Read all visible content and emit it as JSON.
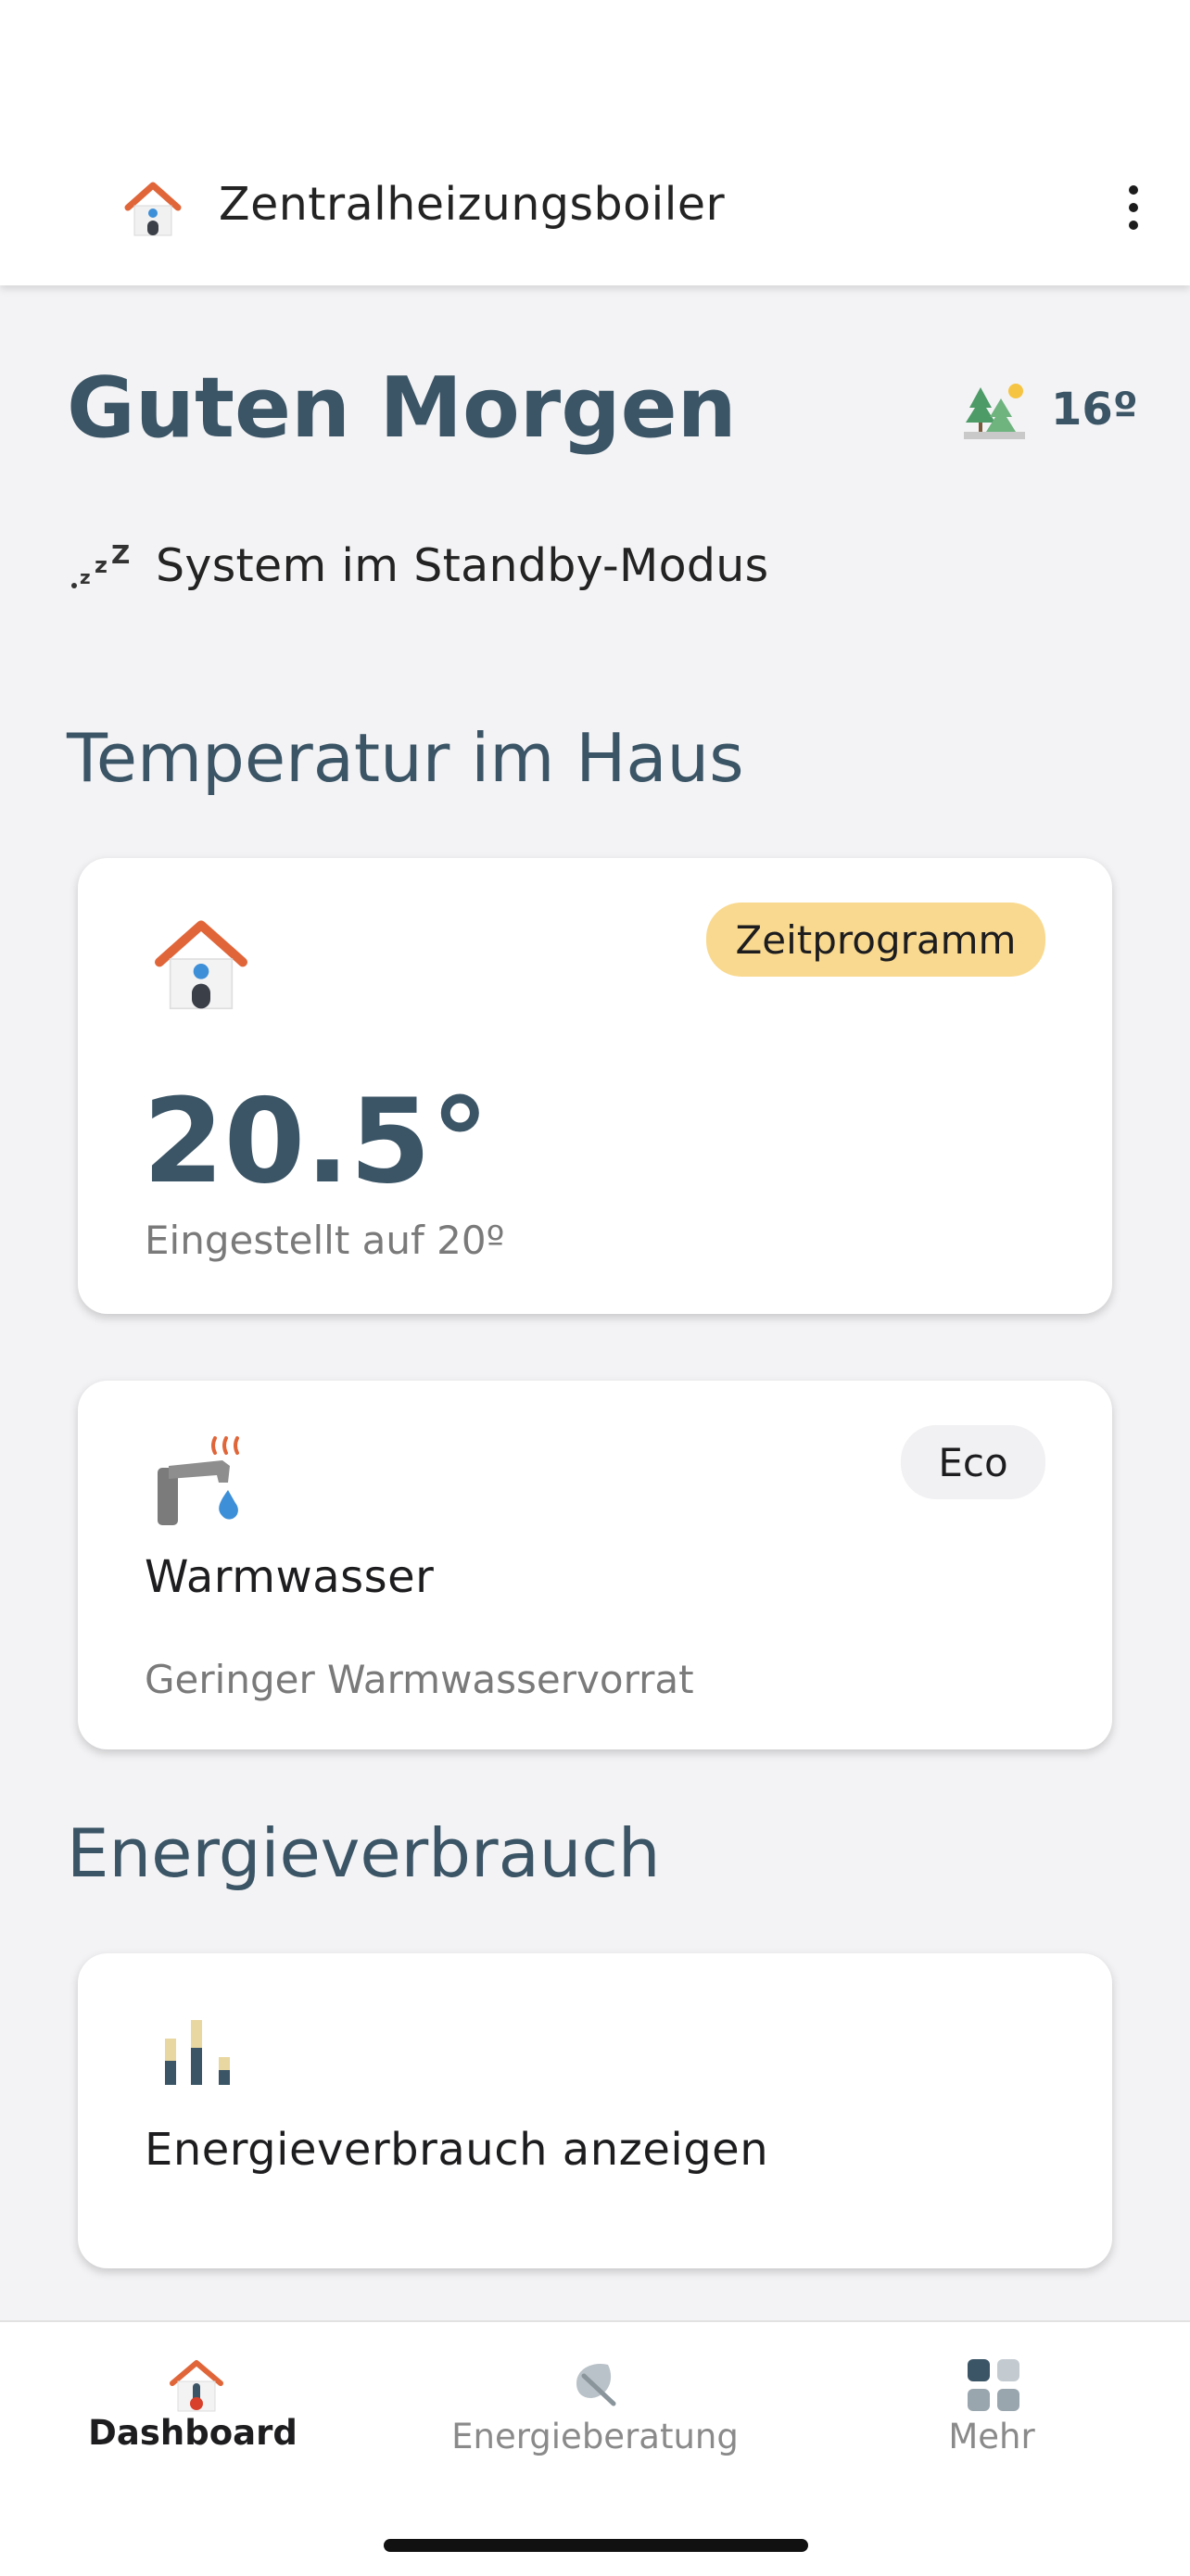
{
  "header": {
    "title": "Zentralheizungsboiler",
    "icon": "house-icon",
    "menu_icon": "more-vertical-icon"
  },
  "greeting": {
    "text": "Guten Morgen",
    "weather_icon": "weather-forest-sun-icon",
    "outdoor_temp": "16º"
  },
  "status": {
    "icon": "sleep-zzz-icon",
    "text": "System im Standby-Modus"
  },
  "sections": {
    "temperature_title": "Temperatur im Haus",
    "energy_title": "Energieverbrauch"
  },
  "room_card": {
    "icon": "house-icon",
    "badge": "Zeitprogramm",
    "current_temp": "20.5°",
    "setpoint": "Eingestellt auf 20º",
    "badge_color": "#f9d98f"
  },
  "water_card": {
    "icon": "hot-water-tap-icon",
    "badge": "Eco",
    "title": "Warmwasser",
    "status": "Geringer Warmwasservorrat"
  },
  "energy_card": {
    "icon": "bar-chart-icon",
    "label": "Energieverbrauch anzeigen"
  },
  "bottom_nav": {
    "items": [
      {
        "label": "Dashboard",
        "icon": "house-thermometer-icon",
        "active": true
      },
      {
        "label": "Energieberatung",
        "icon": "leaf-icon",
        "active": false
      },
      {
        "label": "Mehr",
        "icon": "grid-icon",
        "active": false
      }
    ]
  },
  "colors": {
    "primary": "#3b5566",
    "background": "#f3f3f5",
    "badge": "#f9d98f",
    "badge_neutral": "#f1f1f3"
  }
}
